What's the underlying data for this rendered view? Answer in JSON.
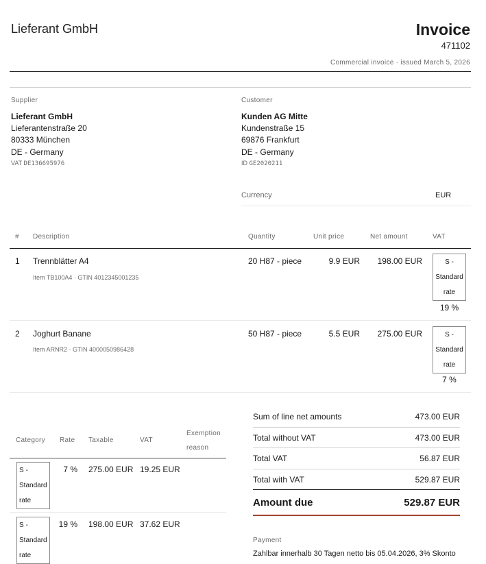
{
  "header": {
    "company": "Lieferant GmbH",
    "doc_type": "Invoice",
    "number": "471102",
    "subtitle": "Commercial invoice · issued March 5, 2026"
  },
  "supplier": {
    "label": "Supplier",
    "name": "Lieferant GmbH",
    "street": "Lieferantenstraße 20",
    "city": "80333 München",
    "country": "DE - Germany",
    "tax_label": "VAT",
    "tax_id": "DE136695976"
  },
  "customer": {
    "label": "Customer",
    "name": "Kunden AG Mitte",
    "street": "Kundenstraße 15",
    "city": "69876 Frankfurt",
    "country": "DE - Germany",
    "id_label": "ID",
    "id": "GE2020211"
  },
  "currency": {
    "label": "Currency",
    "value": "EUR"
  },
  "lines": {
    "headers": {
      "num": "#",
      "desc": "Description",
      "qty": "Quantity",
      "unit": "Unit price",
      "net": "Net amount",
      "vat": "VAT"
    },
    "items": [
      {
        "num": "1",
        "name": "Trennblätter A4",
        "meta": "Item TB100A4 · GTIN 4012345001235",
        "qty": "20 H87 - piece",
        "unit": "9.9 EUR",
        "net": "198.00 EUR",
        "vat_l1": "S -",
        "vat_l2": "Standard",
        "vat_l3": "rate",
        "vat_rate": "19 %"
      },
      {
        "num": "2",
        "name": "Joghurt Banane",
        "meta": "Item ARNR2 · GTIN 4000050986428",
        "qty": "50 H87 - piece",
        "unit": "5.5 EUR",
        "net": "275.00 EUR",
        "vat_l1": "S -",
        "vat_l2": "Standard",
        "vat_l3": "rate",
        "vat_rate": "7 %"
      }
    ]
  },
  "vat_breakdown": {
    "headers": {
      "category": "Category",
      "rate": "Rate",
      "taxable": "Taxable",
      "vat": "VAT",
      "exemption_l1": "Exemption",
      "exemption_l2": "reason"
    },
    "rows": [
      {
        "cat_l1": "S -",
        "cat_l2": "Standard",
        "cat_l3": "rate",
        "rate": "7 %",
        "taxable": "275.00 EUR",
        "vat": "19.25 EUR"
      },
      {
        "cat_l1": "S -",
        "cat_l2": "Standard",
        "cat_l3": "rate",
        "rate": "19 %",
        "taxable": "198.00 EUR",
        "vat": "37.62 EUR"
      }
    ]
  },
  "totals": {
    "rows": [
      {
        "label": "Sum of line net amounts",
        "value": "473.00 EUR"
      },
      {
        "label": "Total without VAT",
        "value": "473.00 EUR"
      },
      {
        "label": "Total VAT",
        "value": "56.87 EUR"
      },
      {
        "label": "Total with VAT",
        "value": "529.87 EUR"
      }
    ],
    "due_label": "Amount due",
    "due_value": "529.87 EUR",
    "accent": "#a0452f"
  },
  "payment": {
    "label": "Payment",
    "text": "Zahlbar innerhalb 30 Tagen netto bis 05.04.2026, 3% Skonto"
  }
}
